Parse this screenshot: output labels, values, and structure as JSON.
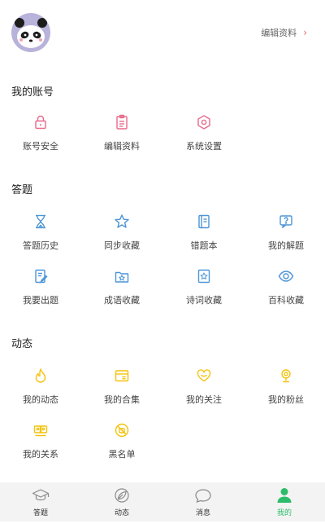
{
  "header": {
    "edit_profile_label": "编辑资料"
  },
  "sections": {
    "account": {
      "title": "我的账号",
      "items": [
        {
          "label": "账号安全",
          "icon": "lock-icon"
        },
        {
          "label": "编辑资料",
          "icon": "clipboard-icon"
        },
        {
          "label": "系统设置",
          "icon": "gear-hexagon-icon"
        }
      ]
    },
    "questions": {
      "title": "答题",
      "items": [
        {
          "label": "答题历史",
          "icon": "hourglass-icon"
        },
        {
          "label": "同步收藏",
          "icon": "star-icon"
        },
        {
          "label": "错题本",
          "icon": "notebook-icon"
        },
        {
          "label": "我的解题",
          "icon": "question-chat-icon"
        },
        {
          "label": "我要出题",
          "icon": "pencil-doc-icon"
        },
        {
          "label": "成语收藏",
          "icon": "star-folder-icon"
        },
        {
          "label": "诗词收藏",
          "icon": "star-card-icon"
        },
        {
          "label": "百科收藏",
          "icon": "eye-icon"
        }
      ]
    },
    "activity": {
      "title": "动态",
      "items": [
        {
          "label": "我的动态",
          "icon": "flame-icon"
        },
        {
          "label": "我的合集",
          "icon": "collection-icon"
        },
        {
          "label": "我的关注",
          "icon": "heart-icon"
        },
        {
          "label": "我的粉丝",
          "icon": "fan-icon"
        },
        {
          "label": "我的关系",
          "icon": "relationship-icon"
        },
        {
          "label": "黑名单",
          "icon": "block-icon"
        }
      ]
    }
  },
  "tabbar": {
    "tabs": [
      {
        "label": "答题",
        "icon": "graduation-cap-icon",
        "active": false
      },
      {
        "label": "动态",
        "icon": "leaf-icon",
        "active": false
      },
      {
        "label": "消息",
        "icon": "message-bubble-icon",
        "active": false
      },
      {
        "label": "我的",
        "icon": "person-icon",
        "active": true
      }
    ]
  },
  "colors": {
    "pink": "#e96a8c",
    "blue": "#4d95d6",
    "yellow": "#f4c20d",
    "active_green": "#2dbc6a",
    "avatar_bg": "#b7b3da"
  }
}
